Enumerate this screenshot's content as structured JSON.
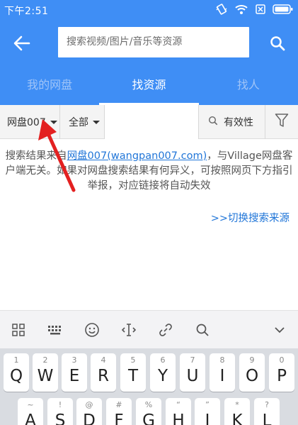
{
  "status_bar": {
    "time": "下午2:51"
  },
  "app_bar": {
    "search_placeholder": "搜索视频/图片/音乐等资源"
  },
  "tabs": [
    {
      "label": "我的网盘",
      "active": false
    },
    {
      "label": "找资源",
      "active": true
    },
    {
      "label": "找人",
      "active": false
    }
  ],
  "filters": {
    "source": "网盘007",
    "category": "全部",
    "validity": "有效性"
  },
  "notice": {
    "prefix": "搜索结果来自",
    "link": "网盘007(wangpan007.com)",
    "suffix": "，与Village网盘客户端无关。如果对网盘搜索结果有何异义，可按照网页下方指引举报，对应链接将自动失效"
  },
  "switch_source": ">>切换搜索来源",
  "keyboard": {
    "row1": [
      {
        "num": "1",
        "ch": "Q"
      },
      {
        "num": "2",
        "ch": "W"
      },
      {
        "num": "3",
        "ch": "E"
      },
      {
        "num": "4",
        "ch": "R"
      },
      {
        "num": "5",
        "ch": "T"
      },
      {
        "num": "6",
        "ch": "Y"
      },
      {
        "num": "7",
        "ch": "U"
      },
      {
        "num": "8",
        "ch": "I"
      },
      {
        "num": "9",
        "ch": "O"
      },
      {
        "num": "0",
        "ch": "P"
      }
    ],
    "row2": [
      {
        "num": "~",
        "ch": "A"
      },
      {
        "num": "!",
        "ch": "S"
      },
      {
        "num": "@",
        "ch": "D"
      },
      {
        "num": "#",
        "ch": "F"
      },
      {
        "num": "%",
        "ch": "G"
      },
      {
        "num": "“",
        "ch": "H"
      },
      {
        "num": "”",
        "ch": "J"
      },
      {
        "num": "*",
        "ch": "K"
      },
      {
        "num": "?",
        "ch": "L"
      }
    ]
  },
  "colors": {
    "primary": "#3f8ef5",
    "link": "#2176d8",
    "annotation_arrow": "#e32020"
  }
}
